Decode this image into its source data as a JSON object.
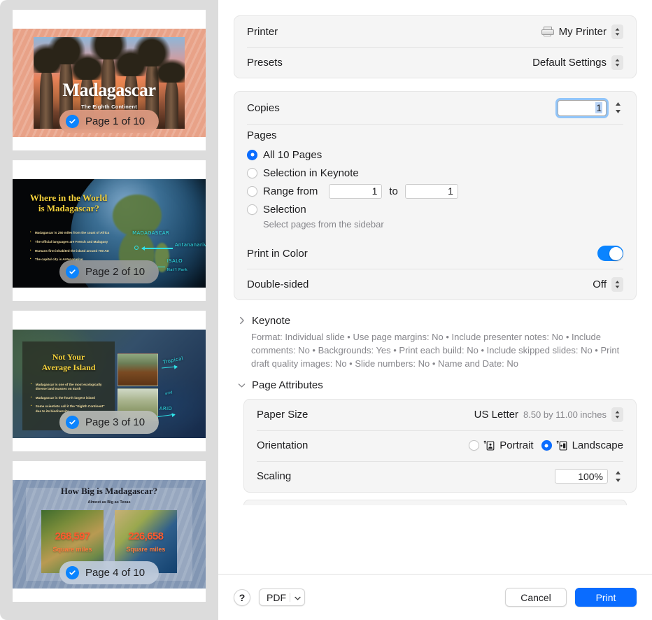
{
  "sidebar": {
    "slides": [
      {
        "badge_label": "Page 1 of 10",
        "selected": true,
        "title": "Madagascar",
        "subtitle": "The Eighth Continent"
      },
      {
        "badge_label": "Page 2 of 10",
        "selected": true,
        "title_line1": "Where in the World",
        "title_line2": "is Madagascar?",
        "bullets": [
          "Madagascar is 250 miles from the coast of Africa",
          "The official languages are French and Malagasy",
          "Humans first inhabited the island around 700 AD",
          "The capital city is Antananarivo"
        ],
        "annotations": [
          "MADAGASCAR",
          "Antananarivo",
          "ISALO",
          "Nat'l Park"
        ]
      },
      {
        "badge_label": "Page 3 of 10",
        "selected": true,
        "title_line1": "Not Your",
        "title_line2": "Average Island",
        "bullets": [
          "Madagascar is one of the most ecologically diverse land masses on Earth",
          "Madagascar is the fourth largest island",
          "Some scientists call it the \"Eighth Continent\" due to its biodiversity"
        ],
        "annotations": [
          "Tropical",
          "ARID"
        ]
      },
      {
        "badge_label": "Page 4 of 10",
        "selected": true,
        "title": "How Big is Madagascar?",
        "subtitle": "Almost as Big as Texas",
        "stats": [
          {
            "number": "268,597",
            "unit": "Square miles"
          },
          {
            "number": "226,658",
            "unit": "Square miles"
          }
        ]
      }
    ]
  },
  "print_dialog": {
    "printer": {
      "label": "Printer",
      "value": "My Printer",
      "icon": "printer-icon"
    },
    "presets": {
      "label": "Presets",
      "value": "Default Settings"
    },
    "copies": {
      "label": "Copies",
      "value": "1"
    },
    "pages": {
      "label": "Pages",
      "options": [
        {
          "label": "All 10 Pages",
          "selected": true
        },
        {
          "label": "Selection in Keynote",
          "selected": false
        },
        {
          "label": "Range from",
          "selected": false
        },
        {
          "label": "Selection",
          "selected": false
        }
      ],
      "range_from": "1",
      "range_to_label": "to",
      "range_to": "1",
      "hint": "Select pages from the sidebar"
    },
    "print_in_color": {
      "label": "Print in Color",
      "enabled": true
    },
    "double_sided": {
      "label": "Double-sided",
      "value": "Off"
    },
    "keynote_section": {
      "title": "Keynote",
      "expanded": false,
      "summary": "Format: Individual slide • Use page margins: No • Include presenter notes: No • Include comments: No • Backgrounds: Yes • Print each build: No • Include skipped slides: No • Print draft quality images: No • Slide numbers: No • Name and Date: No"
    },
    "page_attributes_section": {
      "title": "Page Attributes",
      "expanded": true,
      "paper_size": {
        "label": "Paper Size",
        "value": "US Letter",
        "dimensions": "8.50 by 11.00 inches"
      },
      "orientation": {
        "label": "Orientation",
        "options": [
          {
            "label": "Portrait",
            "selected": false,
            "icon": "portrait-icon"
          },
          {
            "label": "Landscape",
            "selected": true,
            "icon": "landscape-icon"
          }
        ]
      },
      "scaling": {
        "label": "Scaling",
        "value": "100%"
      }
    },
    "footer": {
      "help_label": "?",
      "pdf_label": "PDF",
      "cancel_label": "Cancel",
      "print_label": "Print"
    }
  },
  "colors": {
    "accent_blue": "#0a6cff",
    "toggle_blue": "#0a84ff",
    "sidebar_bg": "#dcdcdc",
    "group_bg": "#f5f5f5",
    "secondary_text": "#86868b"
  }
}
